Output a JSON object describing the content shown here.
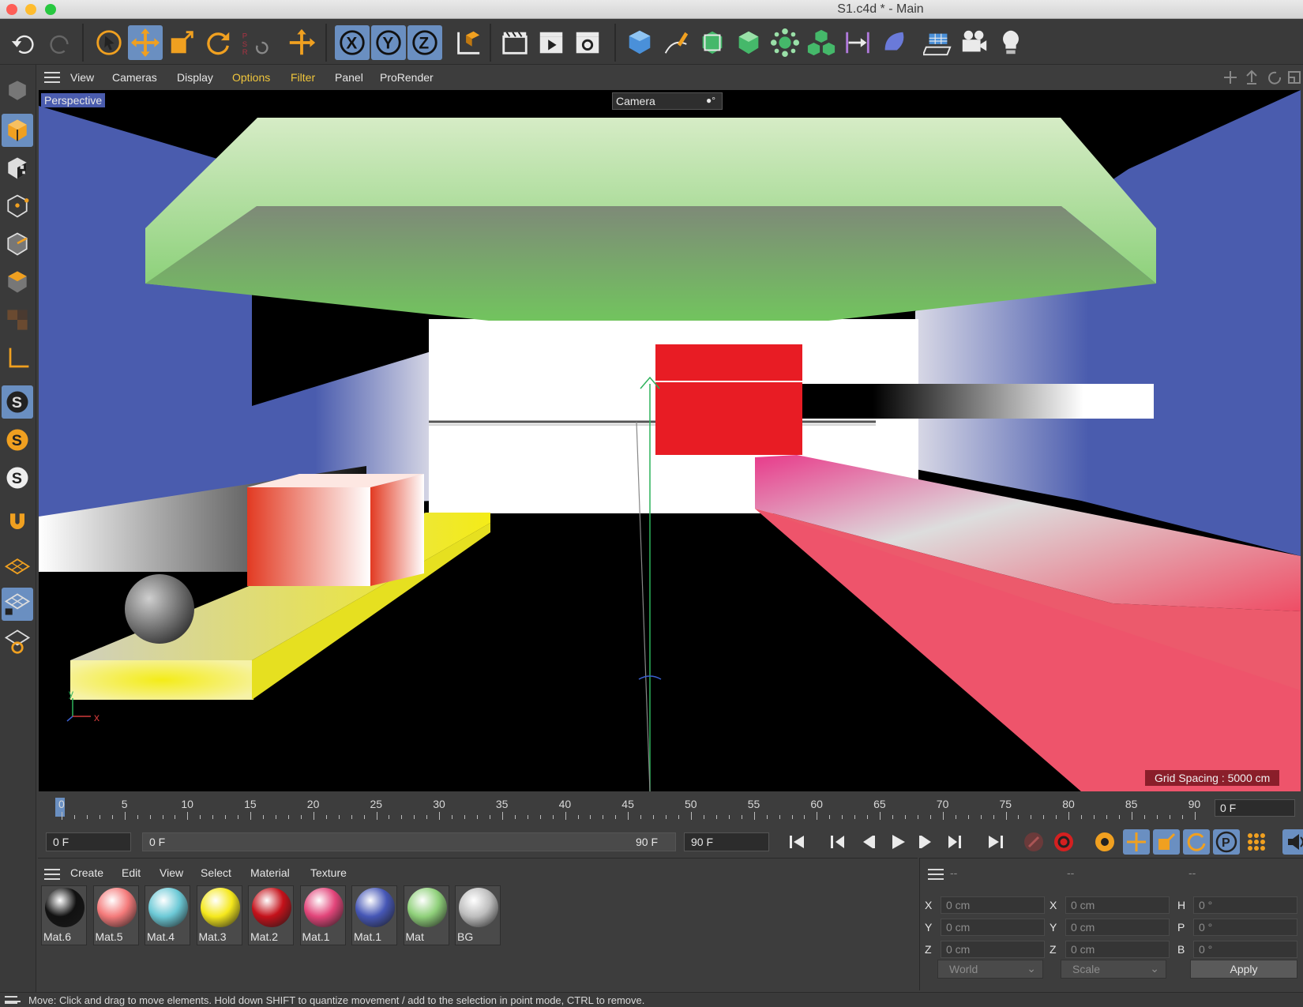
{
  "window": {
    "title": "S1.c4d * - Main"
  },
  "toolbar": {
    "undo": "undo-icon",
    "redo": "redo-icon",
    "tools": [
      "live-selection-icon",
      "move-icon",
      "scale-icon",
      "rotate-icon",
      "psr-icon",
      "world-axis-icon"
    ],
    "axes": [
      "X",
      "Y",
      "Z"
    ],
    "render": [
      "render-region-icon",
      "render-view-icon",
      "render-settings-icon"
    ],
    "objects": [
      "cube-icon",
      "pen-icon",
      "subdivision-icon",
      "extrude-icon",
      "mograph-icon",
      "deformer-icon",
      "spline-icon",
      "field-icon",
      "floor-icon",
      "camera-icon",
      "light-icon"
    ]
  },
  "viewport_menu": {
    "items": [
      "View",
      "Cameras",
      "Display",
      "Options",
      "Filter",
      "Panel",
      "ProRender"
    ]
  },
  "viewport": {
    "mode": "Perspective",
    "camera": "Camera",
    "grid_spacing": "Grid Spacing : 5000 cm",
    "axis_x": "x",
    "axis_y": "y"
  },
  "timeline": {
    "labels": [
      "0",
      "5",
      "10",
      "15",
      "20",
      "25",
      "30",
      "35",
      "40",
      "45",
      "50",
      "55",
      "60",
      "65",
      "70",
      "75",
      "80",
      "85",
      "90"
    ],
    "current_frame": "0 F",
    "start": "0 F",
    "range_start": "0 F",
    "range_end": "90 F",
    "end": "90 F"
  },
  "materials": {
    "menu": [
      "Create",
      "Edit",
      "View",
      "Select",
      "Material",
      "Texture"
    ],
    "items": [
      {
        "name": "Mat.6",
        "color": "#111111"
      },
      {
        "name": "Mat.5",
        "color": "#f47a7a"
      },
      {
        "name": "Mat.4",
        "color": "#6cc9d6"
      },
      {
        "name": "Mat.3",
        "color": "#f5e81c"
      },
      {
        "name": "Mat.2",
        "color": "#c4111a"
      },
      {
        "name": "Mat.1",
        "color": "#e2457a"
      },
      {
        "name": "Mat.1",
        "color": "#4657b6"
      },
      {
        "name": "Mat",
        "color": "#8fd07a"
      },
      {
        "name": "BG",
        "color": "#bdbdbd"
      }
    ]
  },
  "coordinates": {
    "headers": [
      "--",
      "--",
      "--"
    ],
    "rows": [
      {
        "a": "X",
        "av": "0 cm",
        "b": "X",
        "bv": "0 cm",
        "c": "H",
        "cv": "0 °"
      },
      {
        "a": "Y",
        "av": "0 cm",
        "b": "Y",
        "bv": "0 cm",
        "c": "P",
        "cv": "0 °"
      },
      {
        "a": "Z",
        "av": "0 cm",
        "b": "Z",
        "bv": "0 cm",
        "c": "B",
        "cv": "0 °"
      }
    ],
    "space": "World",
    "mode": "Scale",
    "apply": "Apply"
  },
  "status": "Move: Click and drag to move elements. Hold down SHIFT to quantize movement / add to the selection in point mode, CTRL to remove.",
  "colors": {
    "accent": "#6a8fc1",
    "orange": "#f0a020",
    "viewport_wall": "#4a5cae"
  }
}
